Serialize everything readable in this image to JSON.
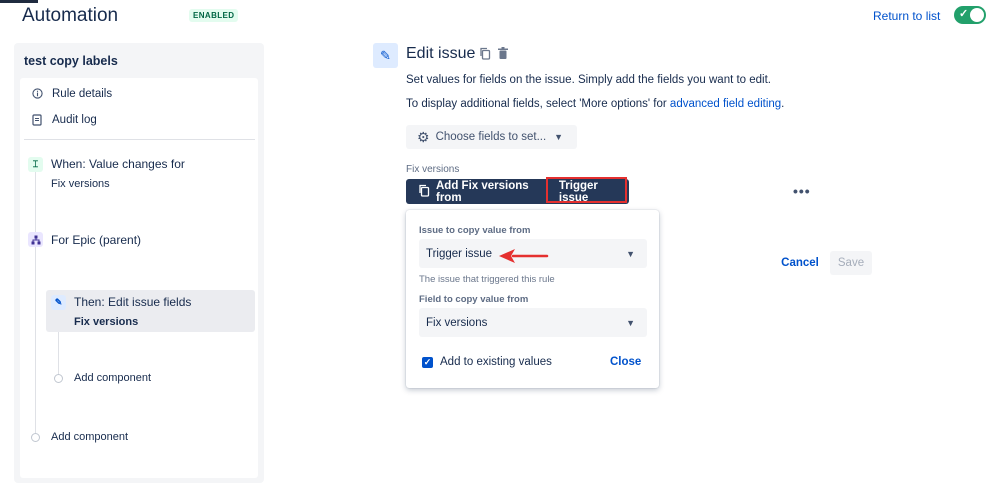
{
  "header": {
    "title": "Automation",
    "status_badge": "ENABLED",
    "return_link": "Return to list",
    "toggle_on": true
  },
  "sidebar": {
    "rule_name": "test copy labels",
    "nav": [
      {
        "label": "Rule details",
        "icon": "info-icon"
      },
      {
        "label": "Audit log",
        "icon": "document-icon"
      }
    ],
    "steps": {
      "trigger_title": "When: Value changes for",
      "trigger_sub": "Fix versions",
      "branch_title": "For Epic (parent)",
      "action_title": "Then: Edit issue fields",
      "action_sub": "Fix versions",
      "add_component_inner": "Add component",
      "add_component_outer": "Add component"
    }
  },
  "main": {
    "title": "Edit issue",
    "desc1": "Set values for fields on the issue. Simply add the fields you want to edit.",
    "desc2_prefix": "To display additional fields, select 'More options' for ",
    "desc2_link": "advanced field editing",
    "desc2_suffix": ".",
    "choose_fields": "Choose fields to set...",
    "field_label": "Fix versions",
    "field_button_prefix": "Add Fix versions from",
    "field_button_source": "Trigger issue",
    "more_icon": "more-horizontal-icon"
  },
  "popover": {
    "copy_from_label": "Issue to copy value from",
    "copy_from_value": "Trigger issue",
    "copy_from_helper": "The issue that triggered this rule",
    "field_label": "Field to copy value from",
    "field_value": "Fix versions",
    "add_existing_label": "Add to existing values",
    "add_existing_checked": true,
    "close_label": "Close"
  },
  "actions": {
    "cancel": "Cancel",
    "save": "Save"
  },
  "colors": {
    "accent": "#0052cc",
    "highlight_border": "#e5302f",
    "dark_button": "#253858",
    "toggle": "#22a06b"
  }
}
